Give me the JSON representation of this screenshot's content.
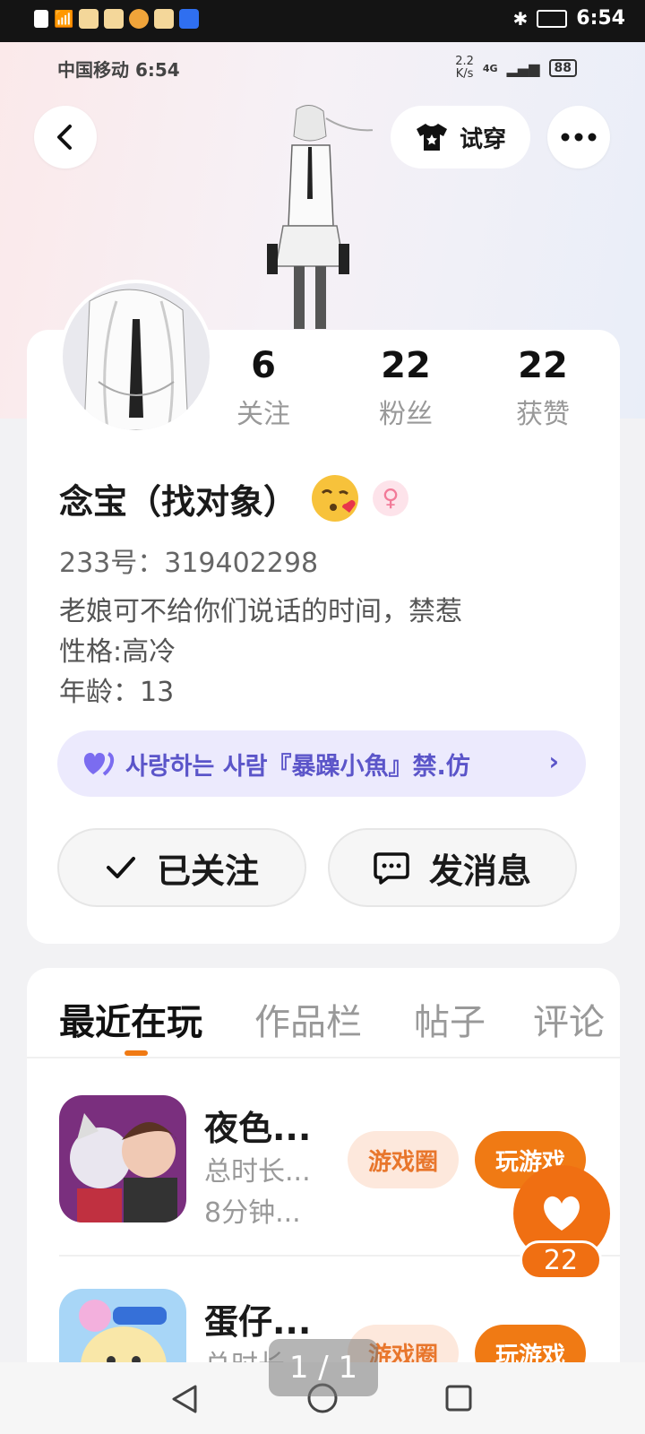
{
  "system_status": {
    "time": "6:54"
  },
  "inner_status": {
    "carrier_time": "中国移动 6:54",
    "speed_value": "2.2",
    "speed_unit": "K/s",
    "network": "4G",
    "battery": "88"
  },
  "header": {
    "try_on_label": "试穿"
  },
  "profile": {
    "stats": [
      {
        "value": "6",
        "label": "关注"
      },
      {
        "value": "22",
        "label": "粉丝"
      },
      {
        "value": "22",
        "label": "获赞"
      }
    ],
    "name": "念宝（找对象）",
    "uid": "233号：319402298",
    "bio": "老娘可不给你们说话的时间，禁惹\n性格:高冷\n年龄：13",
    "cp_text": "사랑하는 사람『暴躁小魚』禁.仿",
    "follow_label": "已关注",
    "message_label": "发消息"
  },
  "tabs": [
    "最近在玩",
    "作品栏",
    "帖子",
    "评论"
  ],
  "games": [
    {
      "title": "夜色...",
      "duration_label": "总时长...",
      "duration_value": "8分钟...",
      "circle_label": "游戏圈",
      "play_label": "玩游戏"
    },
    {
      "title": "蛋仔...",
      "duration_label": "总时长",
      "circle_label": "游戏圈",
      "play_label": "玩游戏"
    }
  ],
  "like_count": "22",
  "pager": "1 / 1",
  "colors": {
    "accent": "#f07a14",
    "cp_bg": "#eceafd",
    "cp_text": "#5b55c9"
  }
}
